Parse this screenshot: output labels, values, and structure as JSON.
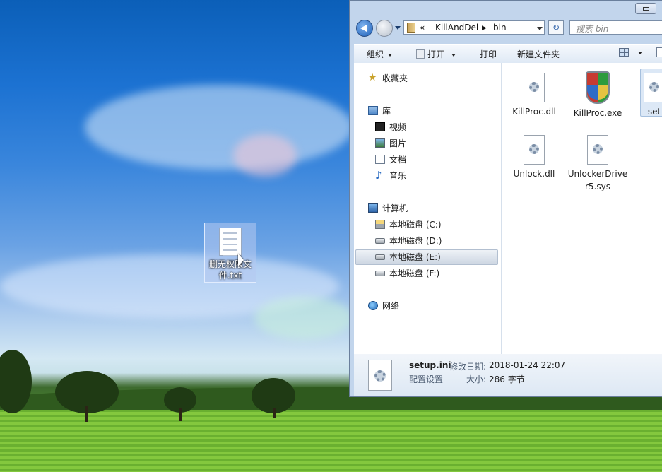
{
  "desktop": {
    "icon_label": "删无权限文件.txt"
  },
  "window": {
    "address": {
      "overflow_glyph": "«",
      "crumbs": [
        "KillAndDel",
        "bin"
      ],
      "separator": "▶"
    },
    "search_placeholder": "搜索 bin",
    "toolbar": {
      "organize": "组织",
      "open": "打开",
      "print": "打印",
      "new_folder": "新建文件夹"
    },
    "nav": {
      "favorites": "收藏夹",
      "libraries": "库",
      "videos": "视频",
      "pictures": "图片",
      "documents": "文档",
      "music": "音乐",
      "computer": "计算机",
      "drive_c": "本地磁盘 (C:)",
      "drive_d": "本地磁盘 (D:)",
      "drive_e": "本地磁盘 (E:)",
      "drive_f": "本地磁盘 (F:)",
      "network": "网络"
    },
    "files": [
      {
        "name": "KillProc.dll",
        "icon": "gear-file-icon"
      },
      {
        "name": "KillProc.exe",
        "icon": "shield-exe-icon"
      },
      {
        "name": "set",
        "icon": "gear-file-icon"
      },
      {
        "name": "Unlock.dll",
        "icon": "gear-file-icon"
      },
      {
        "name": "UnlockerDriver5.sys",
        "icon": "gear-file-icon"
      }
    ],
    "details": {
      "filename": "setup.ini",
      "modified_label": "修改日期:",
      "modified_value": "2018-01-24 22:07",
      "type": "配置设置",
      "size_label": "大小:",
      "size_value": "286 字节"
    }
  }
}
